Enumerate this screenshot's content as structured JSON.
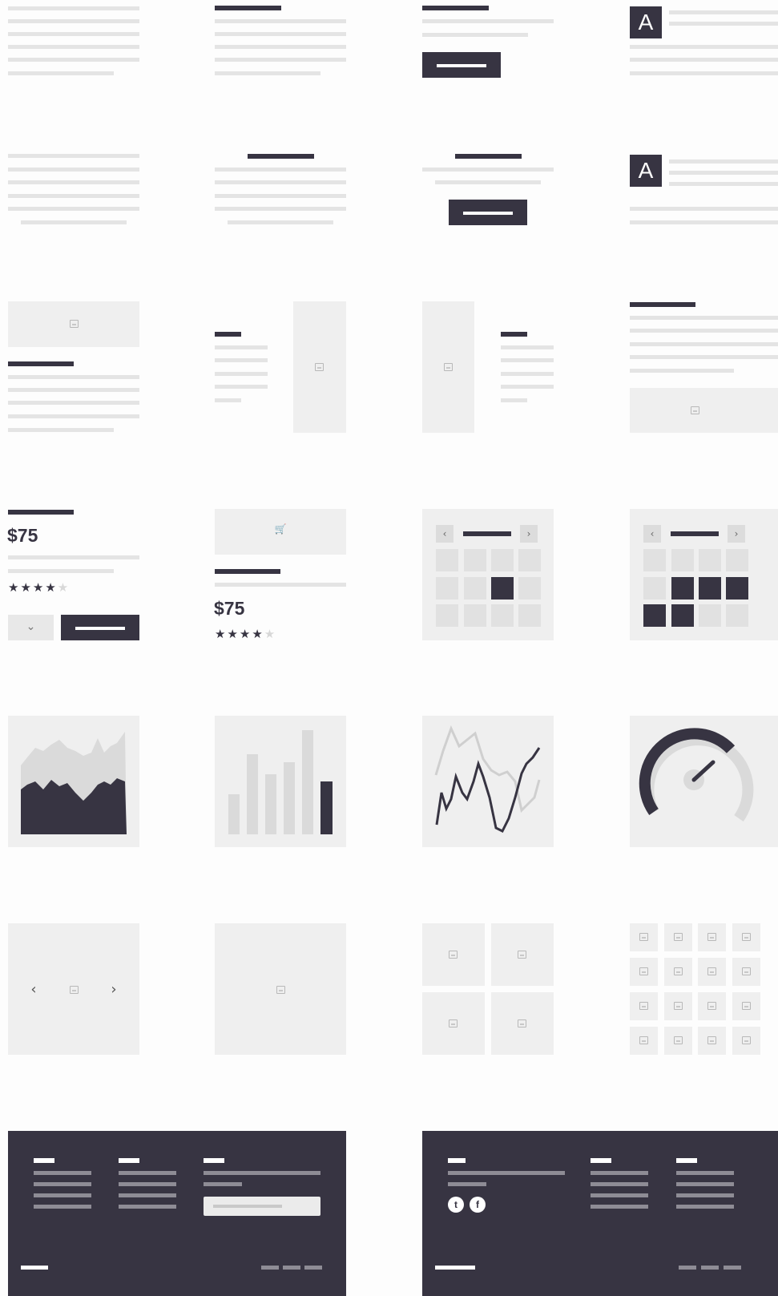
{
  "ui": {
    "heading_letter": "A",
    "price": "$75",
    "stars_filled": "★★★★",
    "stars_empty": "★",
    "chevron_down": "⌄",
    "chevron_left": "‹",
    "chevron_right": "›",
    "cart_glyph": "🛒",
    "twitter": "t",
    "facebook": "f"
  },
  "colors": {
    "dark": "#373442",
    "light": "#e4e4e4",
    "panel": "#efefef",
    "background": "#fdfdfd"
  }
}
